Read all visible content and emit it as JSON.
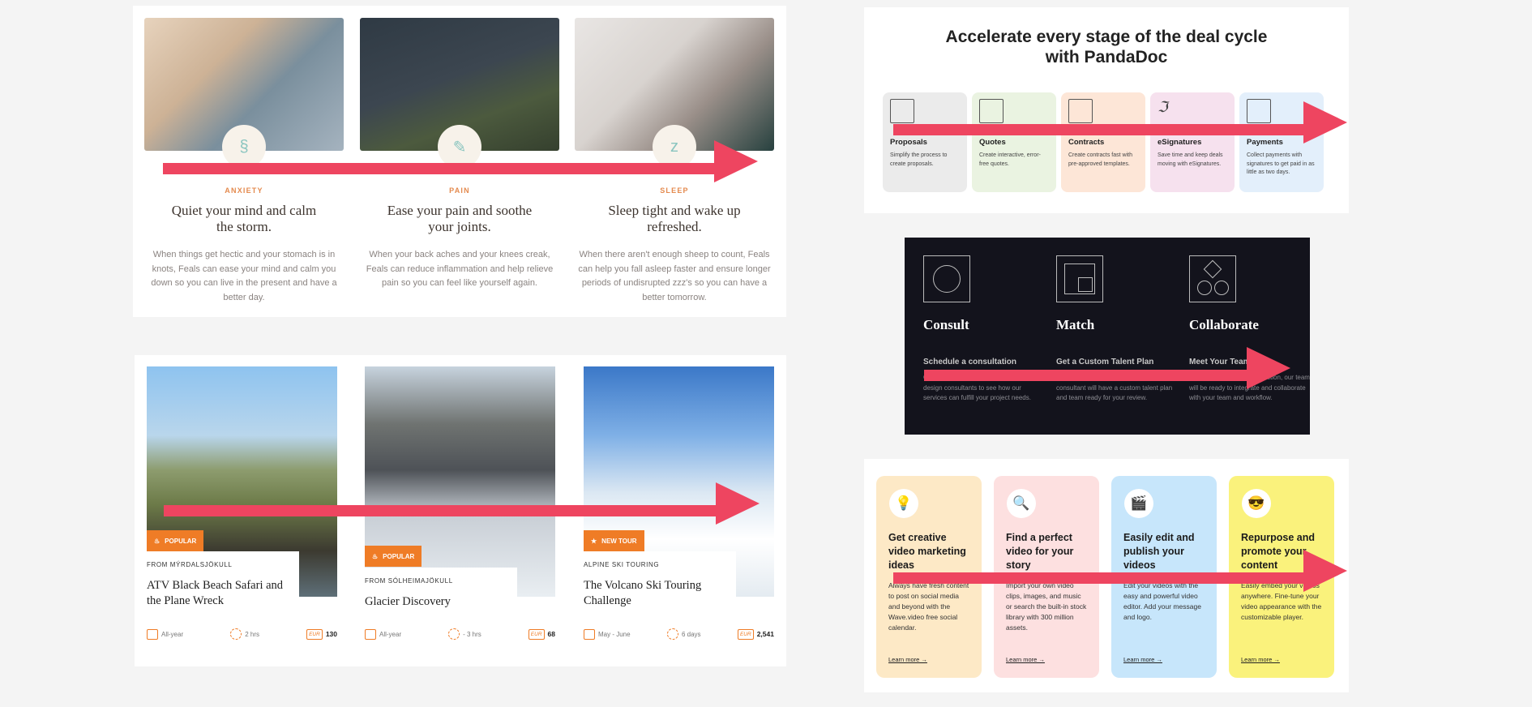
{
  "feals": {
    "items": [
      {
        "category": "ANXIETY",
        "title": "Quiet your mind and calm the storm.",
        "text": "When things get hectic and your stomach is in knots, Feals can ease your mind and calm you down so you can live in the present and have a better day.",
        "icon": "leaf-swirl-icon"
      },
      {
        "category": "PAIN",
        "title": "Ease your pain and soothe your joints.",
        "text": "When your back aches and your knees creak, Feals can reduce inflammation and help relieve pain so you can feel like yourself again.",
        "icon": "bandage-icon"
      },
      {
        "category": "SLEEP",
        "title": "Sleep tight and wake up refreshed.",
        "text": "When there aren't enough sheep to count, Feals can help you fall asleep faster and ensure longer periods of undisrupted zzz's so you can have a better tomorrow.",
        "icon": "zzz-icon"
      }
    ]
  },
  "tours": {
    "items": [
      {
        "tag": "POPULAR",
        "from": "FROM MÝRDALSJÖKULL",
        "title": "ATV Black Beach Safari and the Plane Wreck",
        "season": "All-year",
        "duration": "2 hrs",
        "currency": "EUR",
        "price": "130"
      },
      {
        "tag": "POPULAR",
        "from": "FROM SÓLHEIMAJÖKULL",
        "title": "Glacier Discovery",
        "season": "All-year",
        "duration": "- 3 hrs",
        "currency": "EUR",
        "price": "68"
      },
      {
        "tag": "NEW TOUR",
        "from": "ALPINE SKI TOURING",
        "title": "The Volcano Ski Touring Challenge",
        "season": "May - June",
        "duration": "6 days",
        "currency": "EUR",
        "price": "2,541"
      }
    ]
  },
  "pandadoc": {
    "heading": "Accelerate every stage of the deal cycle with PandaDoc",
    "cards": [
      {
        "title": "Proposals",
        "text": "Simplify the process to create proposals.",
        "color": "#ebebeb"
      },
      {
        "title": "Quotes",
        "text": "Create interactive, error-free quotes.",
        "color": "#eaf3e1"
      },
      {
        "title": "Contracts",
        "text": "Create contracts fast with pre-approved templates.",
        "color": "#fde6d7"
      },
      {
        "title": "eSignatures",
        "text": "Save time and keep deals moving with eSignatures.",
        "color": "#f6e1ee"
      },
      {
        "title": "Payments",
        "text": "Collect payments with signatures to get paid in as little as two days.",
        "color": "#e3effb"
      }
    ]
  },
  "consult": {
    "steps": [
      {
        "title": "Consult",
        "subtitle": "Schedule a consultation",
        "text": "Chat with one of our executive financial design consultants to see how our services can fulfill your project needs."
      },
      {
        "title": "Match",
        "subtitle": "Get a Custom Talent Plan",
        "text": "Within one business day, your design consultant will have a custom talent plan and team ready for your review."
      },
      {
        "title": "Collaborate",
        "subtitle": "Meet Your Team",
        "text": "Once you approve our selection, our team will be ready to integrate and collaborate with your team and workflow."
      }
    ]
  },
  "wave": {
    "cards": [
      {
        "title": "Get creative video marketing ideas",
        "text": "Always have fresh content to post on social media and beyond with the Wave.video free social calendar.",
        "link": "Learn more →",
        "emoji": "💡",
        "color": "#fde9c6"
      },
      {
        "title": "Find a perfect video for your story",
        "text": "Import your own video clips, images, and music or search the built-in stock library with 300 million assets.",
        "link": "Learn more →",
        "emoji": "🔍",
        "color": "#fde0e0"
      },
      {
        "title": "Easily edit and publish your videos",
        "text": "Edit your videos with the easy and powerful video editor. Add your message and logo.",
        "link": "Learn more →",
        "emoji": "🎬",
        "color": "#c7e6fb"
      },
      {
        "title": "Repurpose and promote your content",
        "text": "Easily embed your videos anywhere. Fine-tune your video appearance with the customizable player.",
        "link": "Learn more →",
        "emoji": "😎",
        "color": "#faf27c"
      }
    ]
  }
}
